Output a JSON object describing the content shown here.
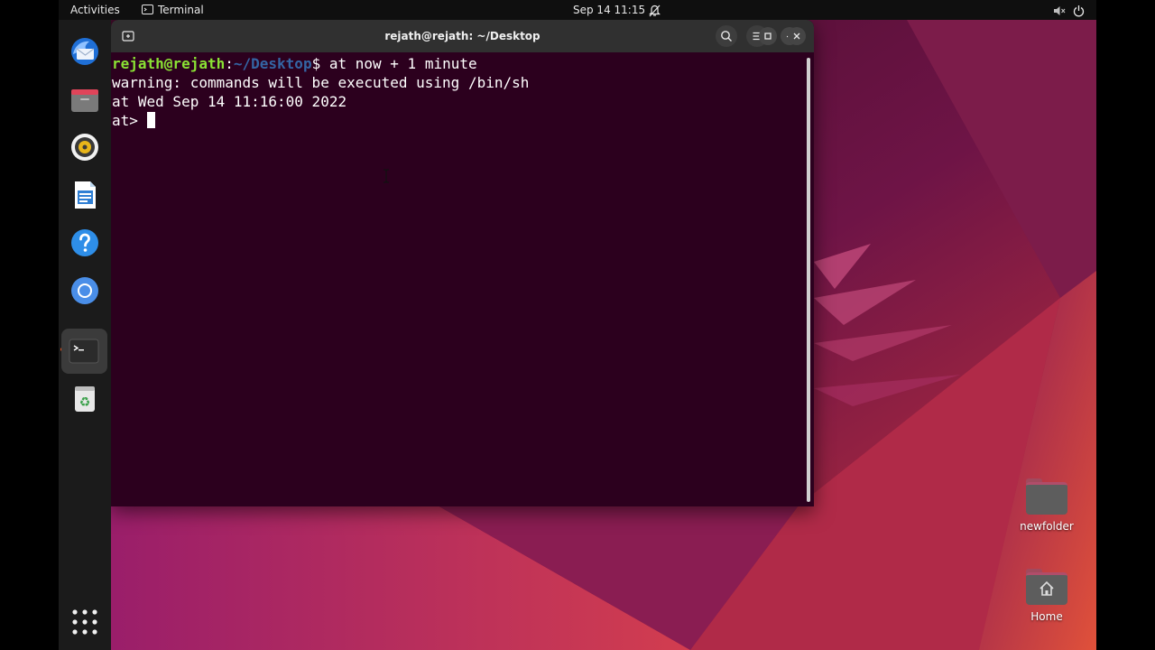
{
  "topbar": {
    "activities": "Activities",
    "app_name": "Terminal",
    "clock": "Sep 14  11:15"
  },
  "dock": {
    "items": [
      "thunderbird-icon",
      "files-icon",
      "rhythmbox-icon",
      "libreoffice-writer-icon",
      "help-icon",
      "chromium-icon",
      "terminal-icon",
      "trash-icon",
      "show-apps-icon"
    ],
    "active": "terminal-icon"
  },
  "window": {
    "title": "rejath@rejath: ~/Desktop"
  },
  "terminal": {
    "prompt_user": "rejath@rejath",
    "prompt_colon": ":",
    "prompt_path": "~/Desktop",
    "prompt_symbol": "$",
    "command": " at now + 1 minute",
    "output": [
      "warning: commands will be executed using /bin/sh",
      "at Wed Sep 14 11:16:00 2022"
    ],
    "at_prompt": "at> ",
    "colors": {
      "background": "#2c001e",
      "user": "#8ae234",
      "path": "#3465a4",
      "text": "#ffffff"
    }
  },
  "desktop": {
    "icons": [
      {
        "label": "newfolder"
      },
      {
        "label": "Home"
      }
    ]
  }
}
